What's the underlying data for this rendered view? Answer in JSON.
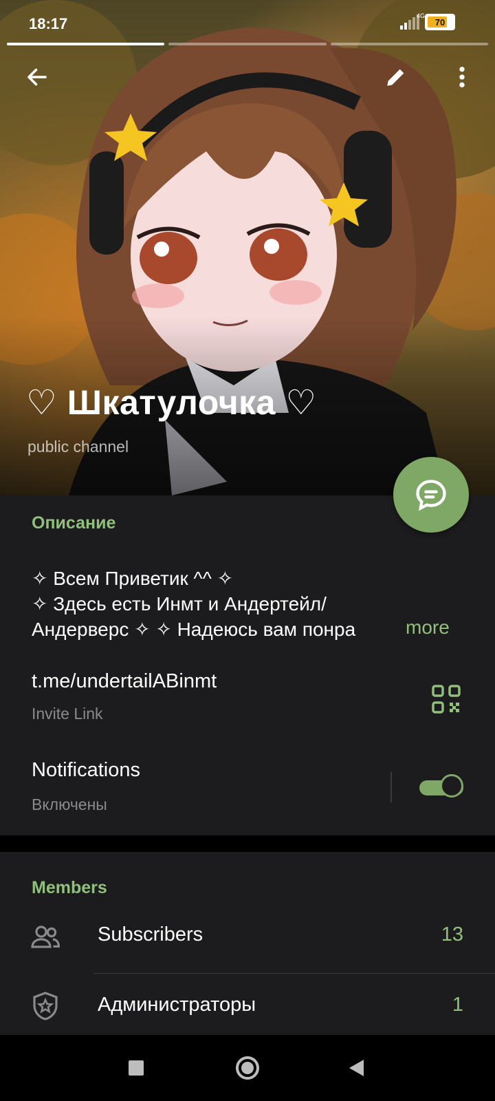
{
  "status_bar": {
    "time": "18:17",
    "network": "4G",
    "battery": "70"
  },
  "header": {
    "back_icon": "arrow-left-icon",
    "edit_icon": "pencil-icon",
    "menu_icon": "more-vertical-icon"
  },
  "channel": {
    "title": "♡ Шкатулочка ♡",
    "subtitle": "public channel"
  },
  "description": {
    "heading": "Описание",
    "lines": [
      "✧ Всем Приветик ^^ ✧",
      "✧  Здесь есть Инмт и Андертейл/",
      "Андерверс ✧ ✧ Надеюсь вам понра"
    ],
    "more_label": "more"
  },
  "invite": {
    "link": "t.me/undertailABinmt",
    "label": "Invite Link"
  },
  "notifications": {
    "label": "Notifications",
    "status": "Включены",
    "enabled": true
  },
  "members": {
    "heading": "Members",
    "items": [
      {
        "label": "Subscribers",
        "count": "13",
        "icon": "people-icon"
      },
      {
        "label": "Администраторы",
        "count": "1",
        "icon": "admin-shield-icon"
      }
    ]
  },
  "colors": {
    "accent": "#90c07a",
    "fab": "#7fa866",
    "card": "#1c1c1e"
  }
}
